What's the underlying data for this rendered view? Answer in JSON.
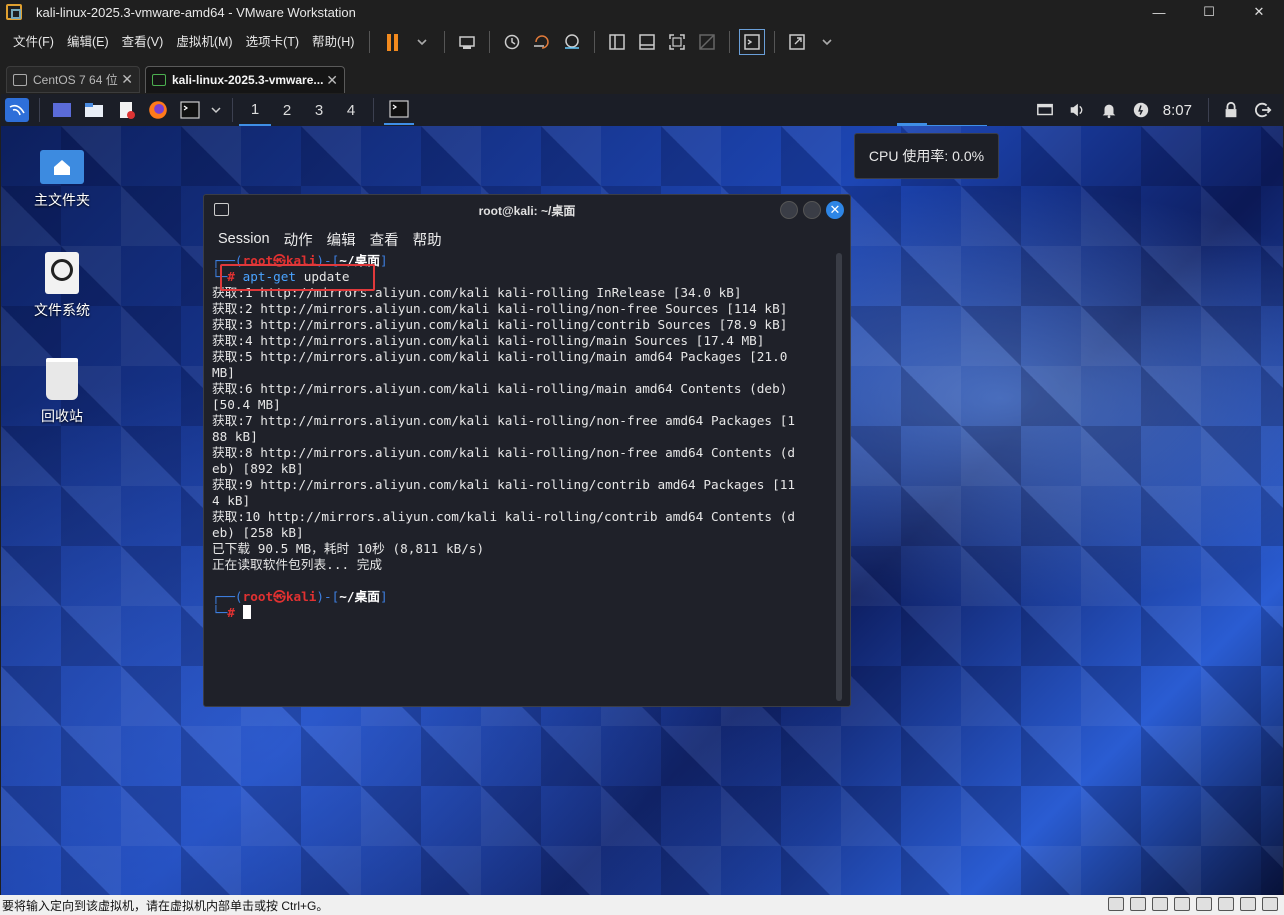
{
  "window": {
    "title": "kali-linux-2025.3-vmware-amd64 - VMware Workstation",
    "minimize": "—",
    "maximize": "☐",
    "close": "✕"
  },
  "menu": [
    "文件(F)",
    "编辑(E)",
    "查看(V)",
    "虚拟机(M)",
    "选项卡(T)",
    "帮助(H)"
  ],
  "tabs": [
    {
      "label": "CentOS 7 64 位",
      "active": false
    },
    {
      "label": "kali-linux-2025.3-vmware...",
      "active": true
    }
  ],
  "kali_panel": {
    "workspaces": [
      "1",
      "2",
      "3",
      "4"
    ],
    "clock": "8:07"
  },
  "cpu_tooltip": "CPU 使用率: 0.0%",
  "desktop_icons": [
    {
      "label": "主文件夹",
      "icon": "home-folder-icon"
    },
    {
      "label": "文件系统",
      "icon": "drive-icon"
    },
    {
      "label": "回收站",
      "icon": "trash-icon"
    }
  ],
  "terminal": {
    "title": "root@kali: ~/桌面",
    "menu": [
      "Session",
      "动作",
      "编辑",
      "查看",
      "帮助"
    ],
    "prompt_user": "root",
    "prompt_at": "㉿",
    "prompt_host": "kali",
    "prompt_dir": "~/桌面",
    "command_word": "apt-get",
    "command_arg": "update",
    "output": [
      "获取:1 http://mirrors.aliyun.com/kali kali-rolling InRelease [34.0 kB]",
      "获取:2 http://mirrors.aliyun.com/kali kali-rolling/non-free Sources [114 kB]",
      "获取:3 http://mirrors.aliyun.com/kali kali-rolling/contrib Sources [78.9 kB]",
      "获取:4 http://mirrors.aliyun.com/kali kali-rolling/main Sources [17.4 MB]",
      "获取:5 http://mirrors.aliyun.com/kali kali-rolling/main amd64 Packages [21.0",
      "MB]",
      "获取:6 http://mirrors.aliyun.com/kali kali-rolling/main amd64 Contents (deb)",
      "[50.4 MB]",
      "获取:7 http://mirrors.aliyun.com/kali kali-rolling/non-free amd64 Packages [1",
      "88 kB]",
      "获取:8 http://mirrors.aliyun.com/kali kali-rolling/non-free amd64 Contents (d",
      "eb) [892 kB]",
      "获取:9 http://mirrors.aliyun.com/kali kali-rolling/contrib amd64 Packages [11",
      "4 kB]",
      "获取:10 http://mirrors.aliyun.com/kali kali-rolling/contrib amd64 Contents (d",
      "eb) [258 kB]",
      "已下载 90.5 MB，耗时 10秒 (8,811 kB/s)",
      "正在读取软件包列表... 完成"
    ]
  },
  "statusbar": "要将输入定向到该虚拟机，请在虚拟机内部单击或按 Ctrl+G。",
  "colors": {
    "accent_orange": "#f28a1e",
    "prompt_red": "#e03131",
    "prompt_blue": "#3d7fe0",
    "highlight": "#e0393b"
  }
}
